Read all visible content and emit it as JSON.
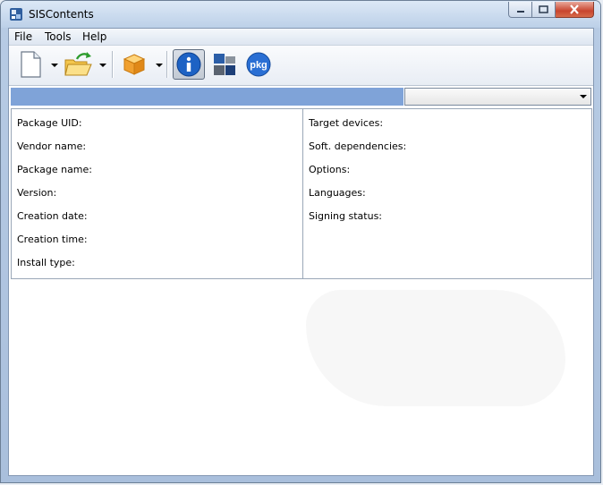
{
  "window": {
    "title": "SISContents"
  },
  "menu": [
    {
      "label": "File",
      "name": "menu-file"
    },
    {
      "label": "Tools",
      "name": "menu-tools"
    },
    {
      "label": "Help",
      "name": "menu-help"
    }
  ],
  "toolbar": {
    "buttons": [
      "new-document-icon",
      "open-folder-icon",
      "package-icon",
      "info-icon",
      "view-tiles-icon",
      "pkg-icon"
    ],
    "pkg_label": "pkg",
    "info_label": "i",
    "pressed": "info-icon"
  },
  "info": {
    "left": [
      {
        "label": "Package UID:"
      },
      {
        "label": "Vendor name:"
      },
      {
        "label": "Package name:"
      },
      {
        "label": "Version:"
      },
      {
        "label": "Creation date:"
      },
      {
        "label": "Creation time:"
      },
      {
        "label": "Install type:"
      }
    ],
    "right": [
      {
        "label": "Target devices:"
      },
      {
        "label": "Soft. dependencies:"
      },
      {
        "label": "Options:"
      },
      {
        "label": "Languages:"
      },
      {
        "label": "Signing status:"
      }
    ]
  },
  "colors": {
    "accent_bar": "#7fa3d8",
    "info_icon": "#1d62c4",
    "pkg_icon": "#2a6fd4",
    "package_icon": "#f0a030",
    "open_arrow": "#2e9c2e"
  }
}
